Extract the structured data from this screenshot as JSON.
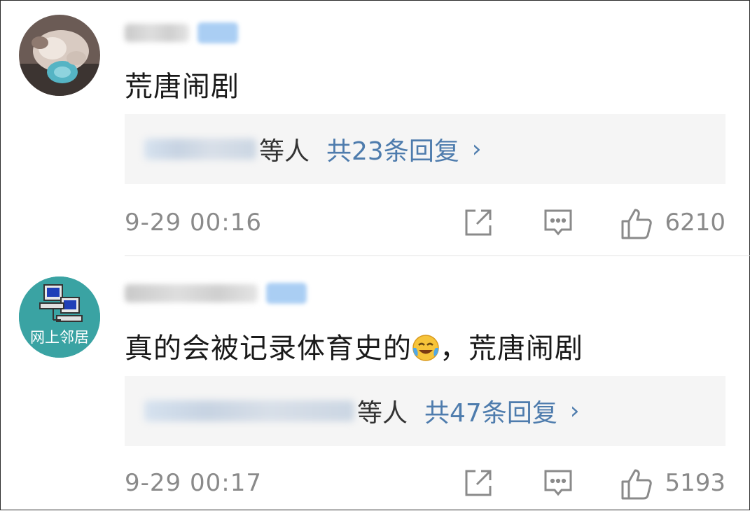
{
  "comments": [
    {
      "text": "荒唐闹剧",
      "reply_suffix": "等人",
      "reply_count": "共23条回复",
      "time": "9-29 00:16",
      "likes": "6210"
    },
    {
      "text_before_emoji": "真的会被记录体育史的",
      "text_after_emoji": "，荒唐闹剧",
      "avatar_caption": "网上邻居",
      "reply_suffix": "等人",
      "reply_count": "共47条回复",
      "time": "9-29 00:17",
      "likes": "5193"
    }
  ],
  "icons": {
    "reply_arrow": "›",
    "share": "share-icon",
    "comment": "comment-icon",
    "like": "thumbs-up-icon",
    "emoji": "laugh-cry-emoji"
  },
  "colors": {
    "link": "#4e7cad",
    "meta": "#8a8a8a",
    "reply_bg": "#f5f5f5"
  }
}
